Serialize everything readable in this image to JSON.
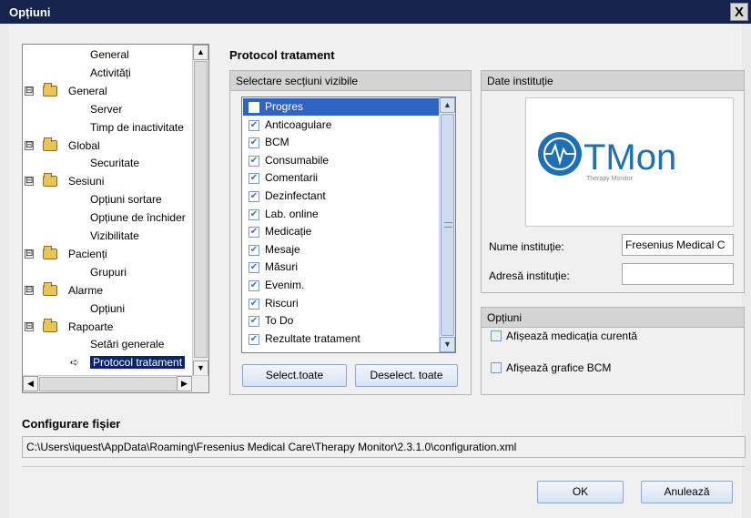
{
  "window": {
    "title": "Opțiuni",
    "close": "X"
  },
  "tree": {
    "items": [
      {
        "label": "General",
        "level": 2
      },
      {
        "label": "Activități",
        "level": 2
      },
      {
        "label": "General",
        "level": 1,
        "expander": "⊟"
      },
      {
        "label": "Server",
        "level": 2
      },
      {
        "label": "Timp de inactivitate",
        "level": 2
      },
      {
        "label": "Global",
        "level": 1,
        "expander": "⊟"
      },
      {
        "label": "Securitate",
        "level": 2
      },
      {
        "label": "Sesiuni",
        "level": 1,
        "expander": "⊟"
      },
      {
        "label": "Opțiuni sortare",
        "level": 2
      },
      {
        "label": "Opțiune de închider",
        "level": 2
      },
      {
        "label": "Vizibilitate",
        "level": 2
      },
      {
        "label": "Pacienți",
        "level": 1,
        "expander": "⊟"
      },
      {
        "label": "Grupuri",
        "level": 2
      },
      {
        "label": "Alarme",
        "level": 1,
        "expander": "⊟"
      },
      {
        "label": "Opțiuni",
        "level": 2
      },
      {
        "label": "Rapoarte",
        "level": 1,
        "expander": "⊟"
      },
      {
        "label": "Setări generale",
        "level": 2
      },
      {
        "label": "Protocol tratament",
        "level": 2,
        "selected": true
      }
    ]
  },
  "protocol": {
    "title": "Protocol tratament",
    "sections_group": "Selectare secțiuni vizibile",
    "sections": [
      {
        "label": "Progres",
        "checked": false,
        "selected": true
      },
      {
        "label": "Anticoagulare",
        "checked": true
      },
      {
        "label": "BCM",
        "checked": true
      },
      {
        "label": "Consumabile",
        "checked": true
      },
      {
        "label": "Comentarii",
        "checked": true
      },
      {
        "label": "Dezinfectant",
        "checked": true
      },
      {
        "label": "Lab. online",
        "checked": true
      },
      {
        "label": "Medicație",
        "checked": true
      },
      {
        "label": "Mesaje",
        "checked": true
      },
      {
        "label": "Măsuri",
        "checked": true
      },
      {
        "label": "Evenim.",
        "checked": true
      },
      {
        "label": "Riscuri",
        "checked": true
      },
      {
        "label": "To Do",
        "checked": true
      },
      {
        "label": "Rezultate tratament",
        "checked": true
      }
    ],
    "select_all": "Select.toate",
    "deselect_all": "Deselect. toate"
  },
  "institution": {
    "group": "Date instituție",
    "logo_main": "TMon",
    "logo_sub": "Therapy Monitor",
    "name_label": "Nume instituție:",
    "name_value": "Fresenius Medical C",
    "address_label": "Adresă instituție:",
    "address_value": ""
  },
  "options": {
    "group": "Opțiuni",
    "show_medication": "Afișează medicația curentă",
    "show_bcm": "Afișează grafice BCM"
  },
  "config": {
    "title": "Configurare fișier",
    "path": "C:\\Users\\iquest\\AppData\\Roaming\\Fresenius Medical Care\\Therapy Monitor\\2.3.1.0\\configuration.xml"
  },
  "buttons": {
    "ok": "OK",
    "cancel": "Anulează"
  },
  "colors": {
    "titlebar": "#15234d",
    "selection": "#0a246a",
    "list_selection": "#2f63c4",
    "logo_blue": "#1f6fb5"
  }
}
